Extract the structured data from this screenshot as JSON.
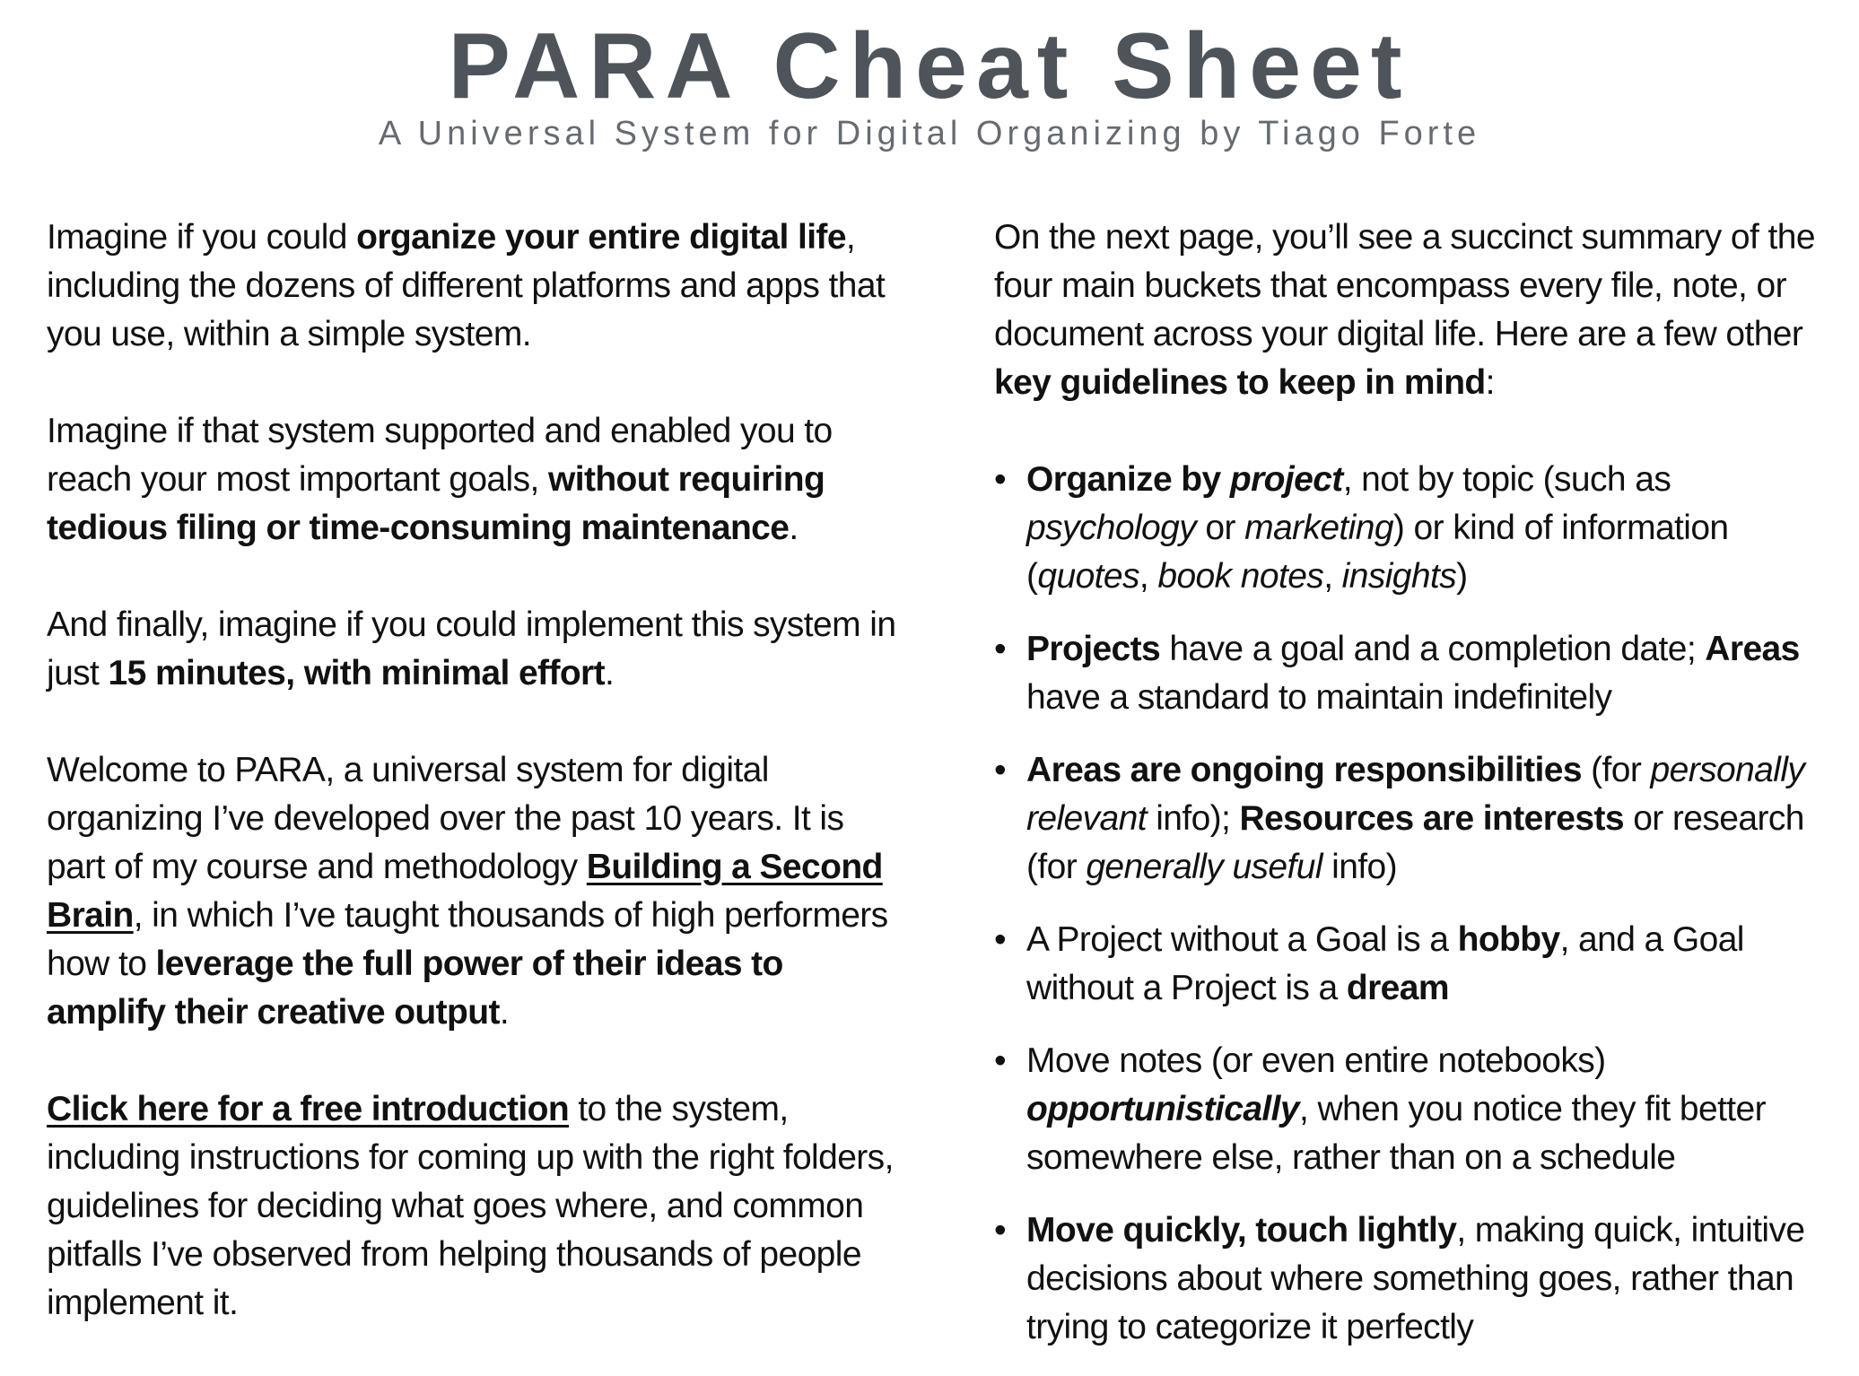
{
  "header": {
    "title": "PARA Cheat Sheet",
    "subtitle": "A Universal System for Digital Organizing by Tiago Forte"
  },
  "left_column": {
    "p1": {
      "a": "Imagine if you could ",
      "b": "organize your entire digital life",
      "c": ", including the dozens of different platforms and apps that you use, within a simple system."
    },
    "p2": {
      "a": "Imagine if that system supported and enabled you to reach your most important goals, ",
      "b": "without requiring tedious filing or time-consuming maintenance",
      "c": "."
    },
    "p3": {
      "a": "And finally, imagine if you could implement this system in just ",
      "b": "15 minutes, with minimal effort",
      "c": "."
    },
    "p4": {
      "a": "Welcome to PARA, a universal system for digital organizing I’ve developed over the past 10 years. It is part of my course and methodology ",
      "link": "Building a Second Brain",
      "b": ", in which I’ve taught thousands of high performers how to ",
      "c": "leverage the full power of their ideas to amplify their creative output",
      "d": "."
    },
    "p5": {
      "link": "Click here for a free introduction",
      "a": " to the system, including instructions for coming up with the right folders, guidelines for deciding what goes where, and common pitfalls I’ve observed from helping thousands of people implement it."
    }
  },
  "right_column": {
    "intro": {
      "a": "On the next page, you’ll see a succinct summary of the four main buckets that encompass every file, note, or document across your digital life. Here are a few other ",
      "b": "key guidelines to keep in mind",
      "c": ":"
    },
    "bullet_char": "•",
    "b1": {
      "a": "Organize by ",
      "b": "project",
      "c": ", not by topic (such as ",
      "d": "psychology",
      "e": " or ",
      "f": "marketing",
      "g": ") or kind of information (",
      "h": "quotes",
      "i": ", ",
      "j": "book notes",
      "k": ", ",
      "l": "insights",
      "m": ")"
    },
    "b2": {
      "a": "Projects",
      "b": " have a goal and a completion date; ",
      "c": "Areas",
      "d": " have a standard to maintain indefinitely"
    },
    "b3": {
      "a": "Areas are ongoing responsibilities",
      "b": " (for ",
      "c": "personally relevant",
      "d": " info); ",
      "e": "Resources are interests",
      "f": " or research (for ",
      "g": "generally useful",
      "h": " info)"
    },
    "b4": {
      "a": "A Project without a Goal is a ",
      "b": "hobby",
      "c": ", and a Goal without a Project is a ",
      "d": "dream"
    },
    "b5": {
      "a": "Move notes (or even entire notebooks) ",
      "b": "opportunistically",
      "c": ", when you notice they fit better somewhere else, rather than on a schedule"
    },
    "b6": {
      "a": "Move quickly, touch lightly",
      "b": ", making quick, intuitive decisions about where something goes, rather than trying to categorize it perfectly"
    }
  }
}
